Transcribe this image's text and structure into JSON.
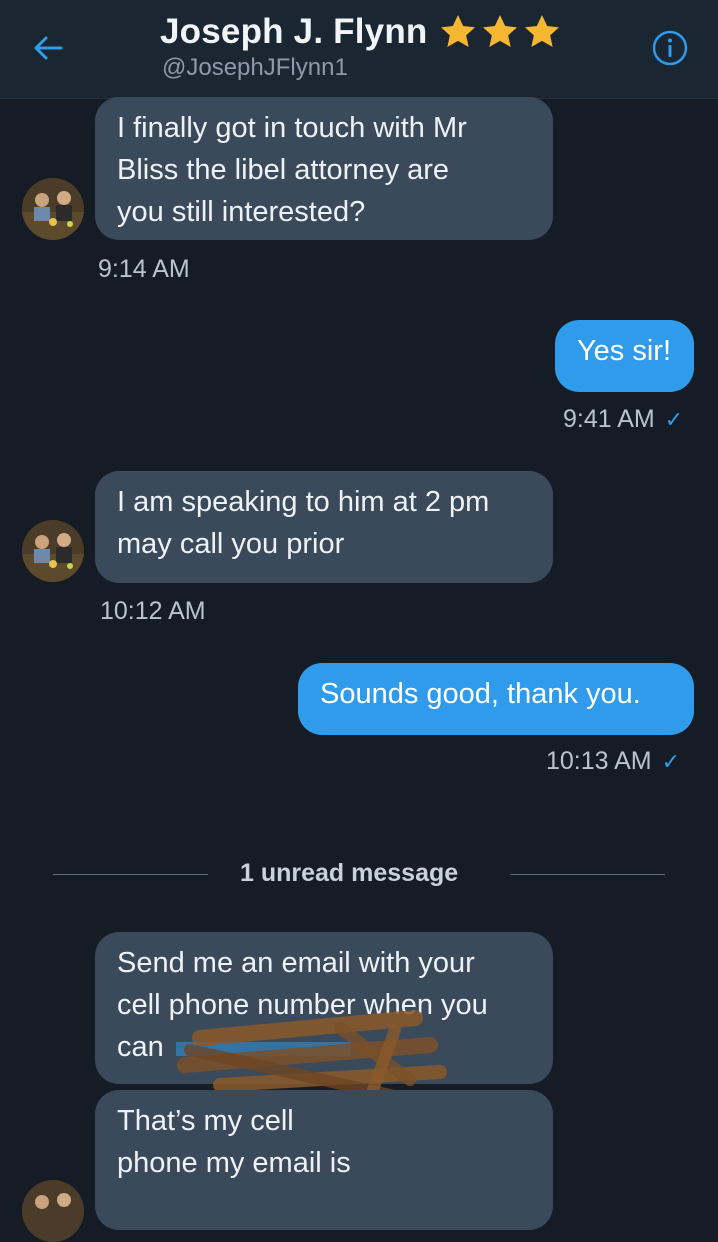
{
  "header": {
    "name": "Joseph J. Flynn",
    "handle": "@JosephJFlynn1",
    "star_color": "#f5b631",
    "accent": "#2f9bea",
    "icons": [
      "back-arrow-icon",
      "star-icon",
      "info-icon"
    ]
  },
  "messages": [
    {
      "direction": "incoming",
      "text_lines": [
        "I finally got in touch with Mr",
        "Bliss the libel attorney are",
        "you still interested?"
      ],
      "time": "9:14 AM"
    },
    {
      "direction": "outgoing",
      "text": "Yes sir!",
      "time": "9:41 AM"
    },
    {
      "direction": "incoming",
      "text_lines": [
        "I am speaking to him at 2 pm",
        "may call you prior"
      ],
      "time": "10:12 AM"
    },
    {
      "direction": "outgoing",
      "text": "Sounds good, thank you.",
      "time": "10:13 AM"
    },
    {
      "direction": "incoming",
      "text_lines": [
        "Send me an email with your",
        "cell phone number when you",
        "can"
      ]
    },
    {
      "direction": "incoming",
      "text_lines": [
        "That’s my cell",
        "phone my email is"
      ]
    }
  ],
  "divider": {
    "label": "1 unread message"
  },
  "read_check": "✓"
}
